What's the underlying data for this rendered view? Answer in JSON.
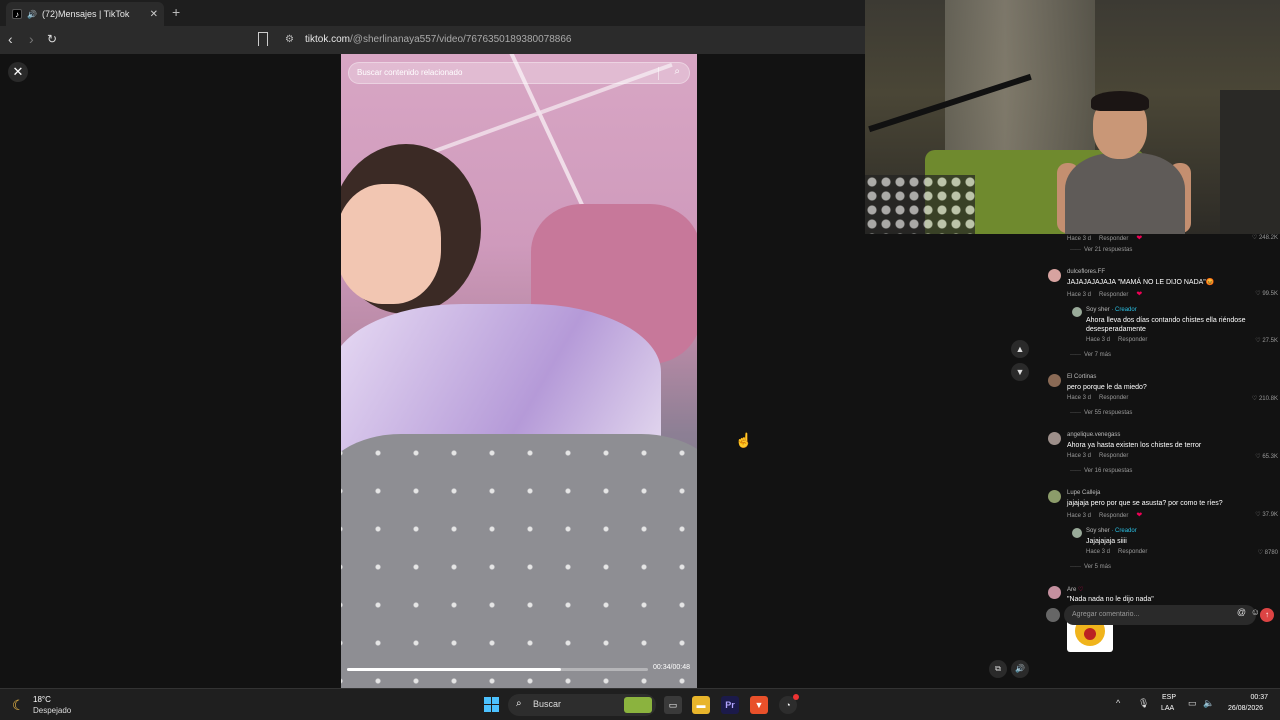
{
  "browser": {
    "tab_title": "(72)Mensajes | TikTok",
    "tab_icon": "tiktok-icon",
    "url_host": "tiktok.com",
    "url_path": "/@sherlinanaya557/video/7676350189380078866"
  },
  "video": {
    "search_placeholder": "Buscar contenido relacionado",
    "time": "00:34/00:48",
    "progress_fraction": 0.71
  },
  "comments": [
    {
      "meta": "Hace 3 d",
      "reply": "Responder",
      "likes": "248.2K",
      "more": "Ver 21 respuestas"
    },
    {
      "user": "dulceflores.FF",
      "text": "JAJAJAJAJAJA \"MAMÁ NO LE DIJO NADA\"😡",
      "meta": "Hace 3 d",
      "reply": "Responder",
      "likes": "99.5K"
    },
    {
      "user": "Soy sher",
      "creator": "· Creador",
      "text": "Ahora lleva dos días contando chistes ella riéndose desesperadamente",
      "meta": "Hace 3 d",
      "reply": "Responder",
      "likes": "27.5K",
      "more": "Ver 7 más"
    },
    {
      "user": "El Cortinas",
      "text": "pero porque le da miedo?",
      "meta": "Hace 3 d",
      "reply": "Responder",
      "likes": "210.8K",
      "more": "Ver 55 respuestas"
    },
    {
      "user": "angelique.venegass",
      "text": "Ahora ya hasta existen los chistes de terror",
      "meta": "Hace 3 d",
      "reply": "Responder",
      "likes": "65.3K",
      "more": "Ver 16 respuestas"
    },
    {
      "user": "Lupe Calleja",
      "text": "jajajaja pero por que se asusta? por como te ríes?",
      "meta": "Hace 3 d",
      "reply": "Responder",
      "likes": "37.9K"
    },
    {
      "user": "Soy sher",
      "creator": "· Creador",
      "text": "Jajajajaja siiii",
      "meta": "Hace 3 d",
      "reply": "Responder",
      "likes": "8780",
      "more": "Ver 5 más"
    },
    {
      "user": "Are",
      "text": "\"Nada nada no le dijo nada\""
    }
  ],
  "comment_input": {
    "placeholder": "Agregar comentario..."
  },
  "taskbar": {
    "temp": "18°C",
    "weather": "Despejado",
    "search": "Buscar",
    "lang1": "ESP",
    "lang2": "LAA",
    "time": "00:37",
    "date": "26/08/2026"
  }
}
